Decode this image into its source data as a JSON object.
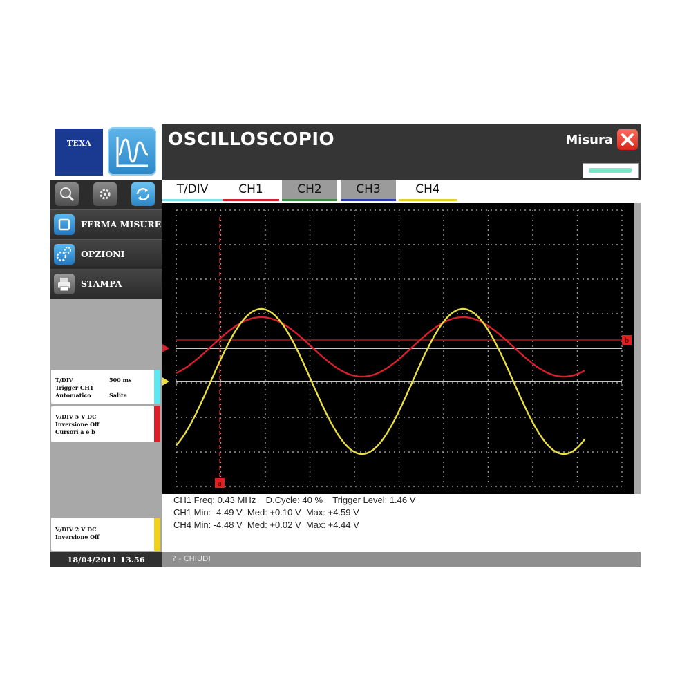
{
  "brand": {
    "logo_text": "TEXA"
  },
  "header": {
    "title": "OSCILLOSCOPIO",
    "mode_label": "Misura"
  },
  "tabs": [
    {
      "label": "T/DIV",
      "color": "#7fe3ef",
      "bg": "#ffffff"
    },
    {
      "label": "CH1",
      "color": "#d8202a",
      "bg": "#ffffff"
    },
    {
      "label": "CH2",
      "color": "#3f8a3f",
      "bg": "#9b9b9b"
    },
    {
      "label": "CH3",
      "color": "#2a3ab0",
      "bg": "#9b9b9b"
    },
    {
      "label": "CH4",
      "color": "#e6d020",
      "bg": "#ffffff"
    }
  ],
  "menu": [
    {
      "label": "FERMA MISURE",
      "icon": "stop-icon"
    },
    {
      "label": "OPZIONI",
      "icon": "gears-icon"
    },
    {
      "label": "STAMPA",
      "icon": "printer-icon"
    }
  ],
  "info_cards": {
    "timebase": {
      "r1a": "T/DIV",
      "r1b": "500 ms",
      "r2": "Trigger CH1",
      "r3a": "Automatico",
      "r3b": "Salita",
      "color": "#5ee7f0"
    },
    "ch1": {
      "r1": "V/DIV  5 V     DC",
      "r2": "Inversione Off",
      "r3": "Cursori a e b",
      "color": "#d8202a"
    },
    "ch4": {
      "r1": "V/DIV  2 V     DC",
      "r2": "Inversione Off",
      "color": "#f0d020"
    }
  },
  "datetime": "18/04/2011  13.56",
  "readout": {
    "line1": "CH1 Freq: 0.43 MHz    D.Cycle: 40 %    Trigger Level: 1.46 V",
    "line2": "CH1 Min: -4.49 V  Med: +0.10 V  Max: +4.59 V",
    "line3": "CH4 Min: -4.48 V  Med: +0.02 V  Max: +4.44 V"
  },
  "status_bar": {
    "hint": "? - CHIUDI"
  },
  "colors": {
    "ch1": "#d8202a",
    "ch4": "#e8df45",
    "grid": "#9a9a9a",
    "cursor": "#e02020",
    "marker": "#e02020"
  },
  "cursor_markers": {
    "vertical": "a",
    "horizontal": "b"
  },
  "chart_data": {
    "type": "line",
    "grid": true,
    "divisions_x": 10,
    "divisions_y": 8,
    "series": [
      {
        "channel": "CH1",
        "color": "#d8202a",
        "min": -4.49,
        "med": 0.1,
        "max": 4.59,
        "volts_per_div": 5
      },
      {
        "channel": "CH4",
        "color": "#e8df45",
        "min": -4.48,
        "med": 0.02,
        "max": 4.44,
        "volts_per_div": 2
      }
    ]
  }
}
